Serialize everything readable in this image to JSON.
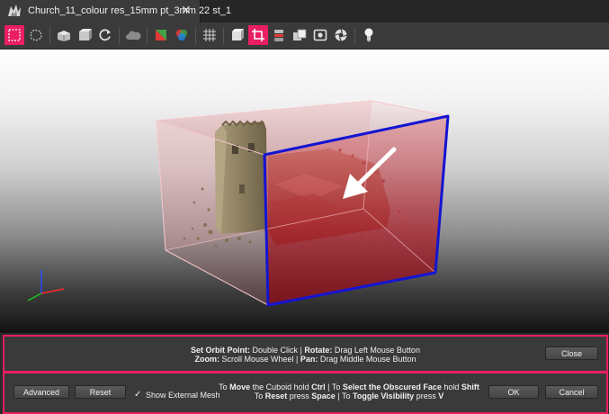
{
  "tab": {
    "title": "Church_11_colour res_15mm pt_3mm 22 st_1",
    "close_glyph": "✕"
  },
  "toolbar": {
    "icons": [
      {
        "name": "rectangle-select-icon",
        "active": true
      },
      {
        "name": "lasso-select-icon",
        "active": false
      },
      {
        "name": "cube-view-icon",
        "active": false
      },
      {
        "name": "cube-view-alt-icon",
        "active": false
      },
      {
        "name": "rotate-icon",
        "active": false
      },
      {
        "name": "cloud-icon",
        "active": false
      },
      {
        "name": "color-triangle-icon",
        "active": false
      },
      {
        "name": "rgb-channels-icon",
        "active": false
      },
      {
        "name": "grid-icon",
        "active": false
      },
      {
        "name": "box-icon",
        "active": false
      },
      {
        "name": "crop-icon",
        "active": true
      },
      {
        "name": "cylinder-stack-icon",
        "active": false
      },
      {
        "name": "boxes-icon",
        "active": false
      },
      {
        "name": "frame-icon",
        "active": false
      },
      {
        "name": "aperture-icon",
        "active": false
      },
      {
        "name": "light-bulb-icon",
        "active": false
      }
    ],
    "accent_color": "#e91e63"
  },
  "viewport": {
    "cuboid_edge_color": "#1414d2",
    "selected_face_color": "#c62828"
  },
  "help": {
    "orbit_label": "Set Orbit Point:",
    "orbit_action": " Double Click | ",
    "rotate_label": "Rotate:",
    "rotate_action": " Drag Left Mouse Button",
    "zoom_label": "Zoom:",
    "zoom_action": " Scroll Mouse Wheel | ",
    "pan_label": "Pan:",
    "pan_action": " Drag Middle Mouse Button",
    "close_label": "Close"
  },
  "actions": {
    "advanced_label": "Advanced",
    "reset_label": "Reset",
    "show_mesh_checked_glyph": "✓",
    "show_mesh_label": "Show External Mesh",
    "hint": {
      "p1": "To ",
      "move": "Move",
      "p2": " the Cuboid hold ",
      "ctrl": "Ctrl",
      "p3": " | To ",
      "select": "Select the Obscured Face",
      "p4": " hold ",
      "shift": "Shift",
      "p5": "To ",
      "reset": "Reset",
      "p6": " press ",
      "space": "Space",
      "p7": " | To ",
      "toggle": "Toggle Visibility",
      "p8": " press ",
      "v": "V"
    },
    "ok_label": "OK",
    "cancel_label": "Cancel"
  }
}
